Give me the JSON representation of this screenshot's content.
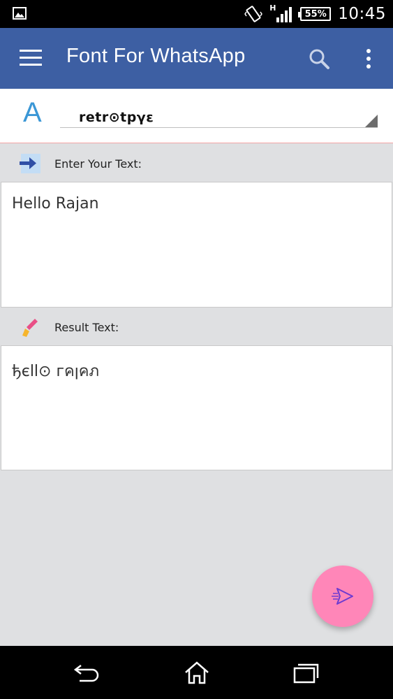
{
  "status_bar": {
    "gallery_icon": "image-icon",
    "network_label": "H",
    "battery": "55%",
    "time": "10:45"
  },
  "app_bar": {
    "title": "Font For WhatsApp",
    "menu_icon": "menu-icon",
    "search_icon": "search-icon",
    "more_icon": "more-vert-icon",
    "color": "#3d5fa3"
  },
  "font_selector": {
    "icon_letter": "A",
    "selected_font": "retr⊙tpγε"
  },
  "input_section": {
    "label": "Enter Your Text:",
    "icon": "arrow-right-icon",
    "value": "Hello Rajan"
  },
  "result_section": {
    "label": "Result Text:",
    "icon": "brush-icon",
    "value": "ђєll⊙ гคןคภ"
  },
  "fab": {
    "icon": "send-icon",
    "color": "#ff86b8"
  },
  "nav_bar": {
    "back_icon": "back-icon",
    "home_icon": "home-icon",
    "recents_icon": "recents-icon"
  }
}
